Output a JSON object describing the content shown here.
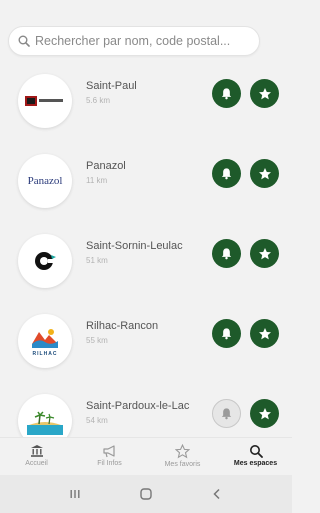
{
  "search": {
    "placeholder": "Rechercher par nom, code postal..."
  },
  "communes": [
    {
      "name": "Saint-Paul",
      "distance": "5.6 km",
      "alerts": true
    },
    {
      "name": "Panazol",
      "distance": "11 km",
      "alerts": true
    },
    {
      "name": "Saint-Sornin-Leulac",
      "distance": "51 km",
      "alerts": true
    },
    {
      "name": "Rilhac-Rancon",
      "distance": "55 km",
      "alerts": true
    },
    {
      "name": "Saint-Pardoux-le-Lac",
      "distance": "54 km",
      "alerts": false
    }
  ],
  "logos": {
    "panazol_text": "Panazol",
    "rilhac_text": "RILHAC"
  },
  "tabs": [
    {
      "label": "Accueil",
      "icon": "bank-icon"
    },
    {
      "label": "Fil Infos",
      "icon": "megaphone-icon"
    },
    {
      "label": "Mes favoris",
      "icon": "star-icon"
    },
    {
      "label": "Mes espaces",
      "icon": "search-icon"
    }
  ],
  "colors": {
    "accent": "#1e5a2a",
    "inactive": "#e6e6e6"
  }
}
